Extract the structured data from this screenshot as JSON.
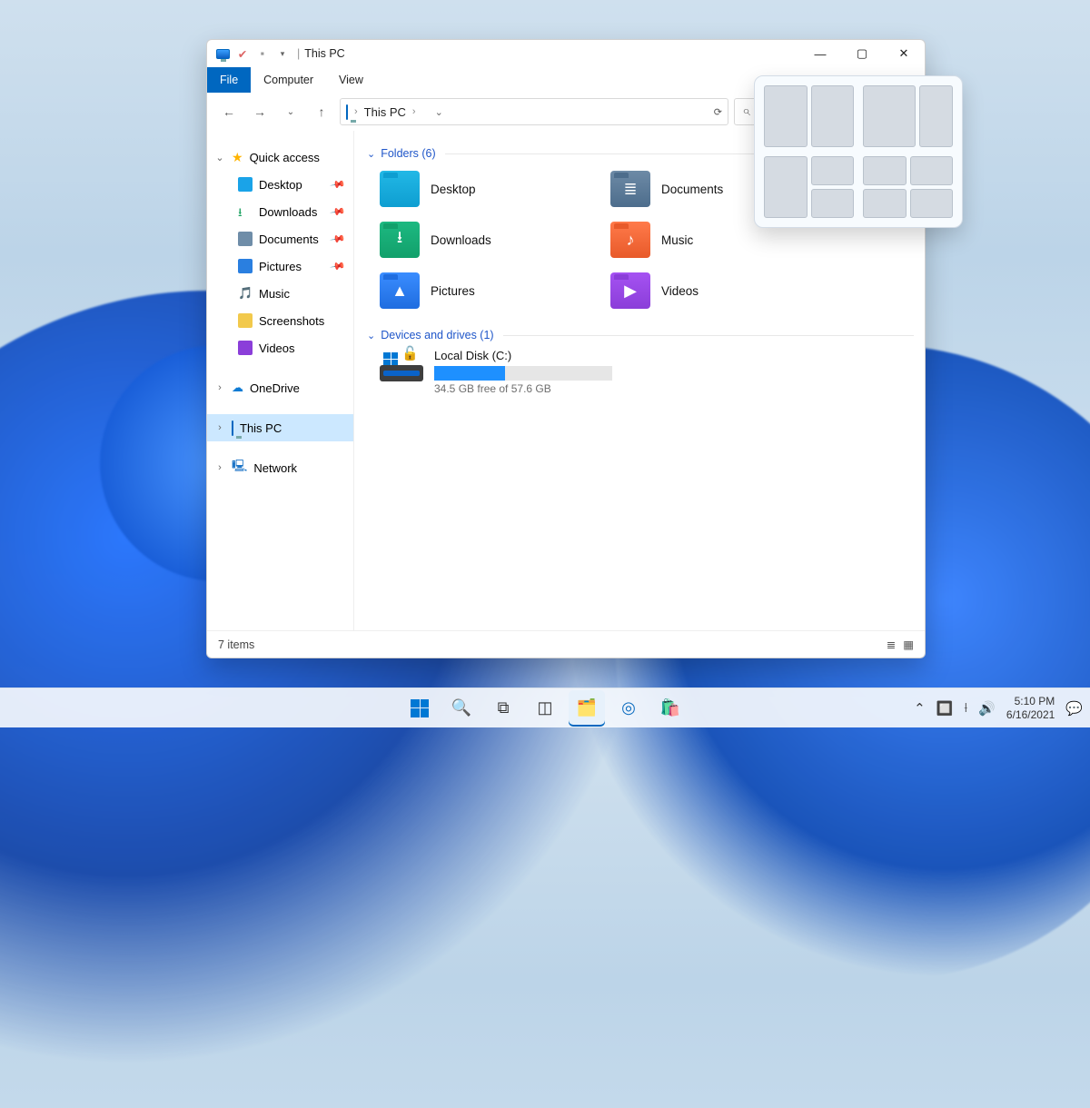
{
  "titlebar": {
    "title": "This PC"
  },
  "ribbon": {
    "file": "File",
    "computer": "Computer",
    "view": "View"
  },
  "address": {
    "location": "This PC"
  },
  "nav": {
    "quick_access": "Quick access",
    "items": [
      "Desktop",
      "Downloads",
      "Documents",
      "Pictures",
      "Music",
      "Screenshots",
      "Videos"
    ],
    "onedrive": "OneDrive",
    "this_pc": "This PC",
    "network": "Network"
  },
  "folders": {
    "header": "Folders (6)",
    "items": [
      "Desktop",
      "Downloads",
      "Pictures",
      "Documents",
      "Music",
      "Videos"
    ]
  },
  "drives": {
    "header": "Devices and drives (1)",
    "name": "Local Disk (C:)",
    "free_text": "34.5 GB free of 57.6 GB",
    "fill_pct": 40
  },
  "status": {
    "count": "7 items"
  },
  "tray": {
    "time": "5:10 PM",
    "date": "6/16/2021"
  }
}
